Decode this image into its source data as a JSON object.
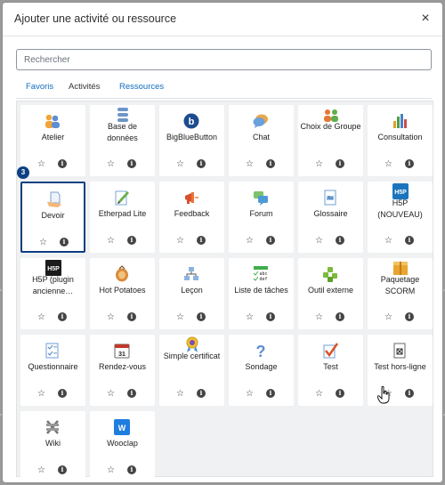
{
  "modal": {
    "title": "Ajouter une activité ou ressource",
    "close_symbol": "×"
  },
  "search": {
    "placeholder": "Rechercher",
    "value": ""
  },
  "tabs": [
    {
      "label": "Favoris",
      "active": false
    },
    {
      "label": "Activités",
      "active": true
    },
    {
      "label": "Ressources",
      "active": false
    }
  ],
  "activities": [
    {
      "label": "Atelier",
      "icon": "workshop-icon"
    },
    {
      "label": "Base de données",
      "icon": "database-icon"
    },
    {
      "label": "BigBlueButton",
      "icon": "bigbluebutton-icon"
    },
    {
      "label": "Chat",
      "icon": "chat-icon"
    },
    {
      "label": "Choix de Groupe",
      "icon": "group-choice-icon"
    },
    {
      "label": "Consultation",
      "icon": "consultation-icon"
    },
    {
      "label": "Devoir",
      "icon": "assignment-icon",
      "selected": true
    },
    {
      "label": "Etherpad Lite",
      "icon": "etherpad-icon"
    },
    {
      "label": "Feedback",
      "icon": "feedback-icon"
    },
    {
      "label": "Forum",
      "icon": "forum-icon"
    },
    {
      "label": "Glossaire",
      "icon": "glossary-icon"
    },
    {
      "label": "H5P (NOUVEAU)",
      "icon": "h5p-icon"
    },
    {
      "label": "H5P (plugin ancienne…",
      "icon": "h5p-plugin-icon"
    },
    {
      "label": "Hot Potatoes",
      "icon": "hotpotatoes-icon"
    },
    {
      "label": "Leçon",
      "icon": "lesson-icon"
    },
    {
      "label": "Liste de tâches",
      "icon": "checklist-icon"
    },
    {
      "label": "Outil externe",
      "icon": "external-tool-icon"
    },
    {
      "label": "Paquetage SCORM",
      "icon": "scorm-icon"
    },
    {
      "label": "Questionnaire",
      "icon": "questionnaire-icon"
    },
    {
      "label": "Rendez-vous",
      "icon": "scheduler-icon"
    },
    {
      "label": "Simple certificat",
      "icon": "certificate-icon"
    },
    {
      "label": "Sondage",
      "icon": "survey-icon"
    },
    {
      "label": "Test",
      "icon": "quiz-icon"
    },
    {
      "label": "Test hors-ligne",
      "icon": "offline-quiz-icon"
    },
    {
      "label": "Wiki",
      "icon": "wiki-icon"
    },
    {
      "label": "Wooclap",
      "icon": "wooclap-icon"
    }
  ],
  "icon_glyphs": {
    "bigbluebutton": "b",
    "h5p": "H5P",
    "h5p_plugin": "H5P",
    "wooclap": "W",
    "calendar_day": "31",
    "checklist_lines": [
      "abc",
      "def"
    ],
    "star": "☆",
    "info": "i"
  },
  "step_badge": "3",
  "colors": {
    "accent": "#0f6cbf",
    "selected_border": "#0b3f82",
    "grid_bg": "#f0f1f3"
  }
}
